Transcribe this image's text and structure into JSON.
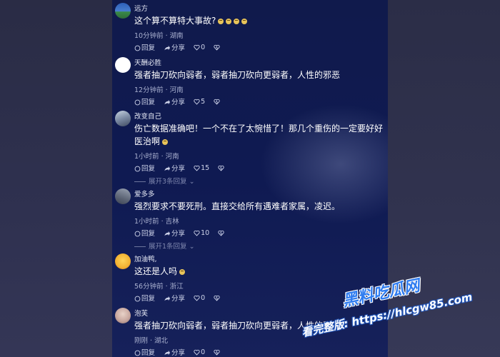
{
  "comments": [
    {
      "user": "远方",
      "text": "这个算不算特大事故?",
      "emojis": 4,
      "time": "10分钟前 · 湖南",
      "reply": "回复",
      "share": "分享",
      "likes": "0",
      "avatar_color": "#3f6fb0"
    },
    {
      "user": "天酬必胜",
      "text": "强者抽刀砍向弱者，弱者抽刀砍向更弱者，人性的邪恶",
      "emojis": 0,
      "time": "12分钟前 · 河南",
      "reply": "回复",
      "share": "分享",
      "likes": "5",
      "avatar_color": "#ffffff"
    },
    {
      "user": "改变自己",
      "text": "伤亡数据准确吧！一个不在了太惋惜了！那几个重伤的一定要好好医治啊",
      "emojis": 1,
      "time": "1小时前 · 河南",
      "reply": "回复",
      "share": "分享",
      "likes": "15",
      "expand": "展开3条回复",
      "avatar_color": "#8a9ab0"
    },
    {
      "user": "爱多多",
      "text": "强烈要求不要死刑。直接交给所有遇难者家属，凌迟。",
      "emojis": 0,
      "time": "1小时前 · 吉林",
      "reply": "回复",
      "share": "分享",
      "likes": "10",
      "expand": "展开1条回复",
      "avatar_color": "#6f7688"
    },
    {
      "user": "加油鸭,",
      "text": "这还是人吗",
      "emojis": 1,
      "time": "56分钟前 · 浙江",
      "reply": "回复",
      "share": "分享",
      "likes": "0",
      "avatar_color": "#f2b233"
    },
    {
      "user": "泡芙",
      "text": "强者抽刀砍向弱者，弱者抽刀砍向更弱者，人性的邪恶",
      "emojis": 0,
      "time": "刚刚 · 湖北",
      "reply": "回复",
      "share": "分享",
      "likes": "0",
      "avatar_color": "#c9a8a0"
    }
  ],
  "watermark": {
    "line1": "黑料吃瓜网",
    "line2": "看完整版: https://hlcgw85.com"
  }
}
